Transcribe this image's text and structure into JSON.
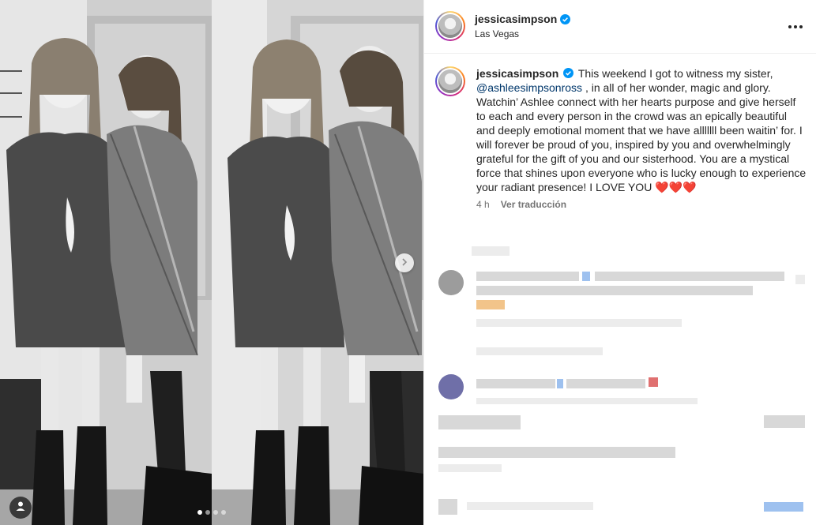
{
  "post": {
    "username": "jessicasimpson",
    "location": "Las Vegas",
    "verified_icon": "verified-badge-icon",
    "more_icon": "more-options-icon"
  },
  "caption": {
    "username": "jessicasimpson",
    "text_intro": "This weekend I got to witness my sister,",
    "mention": "@ashleesimpsonross",
    "text_body": ", in all of her wonder, magic and glory. Watchin’ Ashlee connect with her hearts purpose and give herself to each and every person in the crowd was an epically beautiful and deeply emotional moment that we have alllllll been waitin’ for. I will forever be proud of you, inspired by you and overwhelmingly grateful for the gift of you and our sisterhood. You are a mystical force that shines upon everyone who is lucky enough to experience your radiant presence! I LOVE YOU ❤️❤️❤️",
    "time_ago": "4 h",
    "translate_label": "Ver traducción"
  },
  "carousel": {
    "slide_count": 4,
    "active_index": 0
  },
  "colors": {
    "link": "#00376b",
    "verified": "#0095f6",
    "secondary_text": "#737373"
  }
}
